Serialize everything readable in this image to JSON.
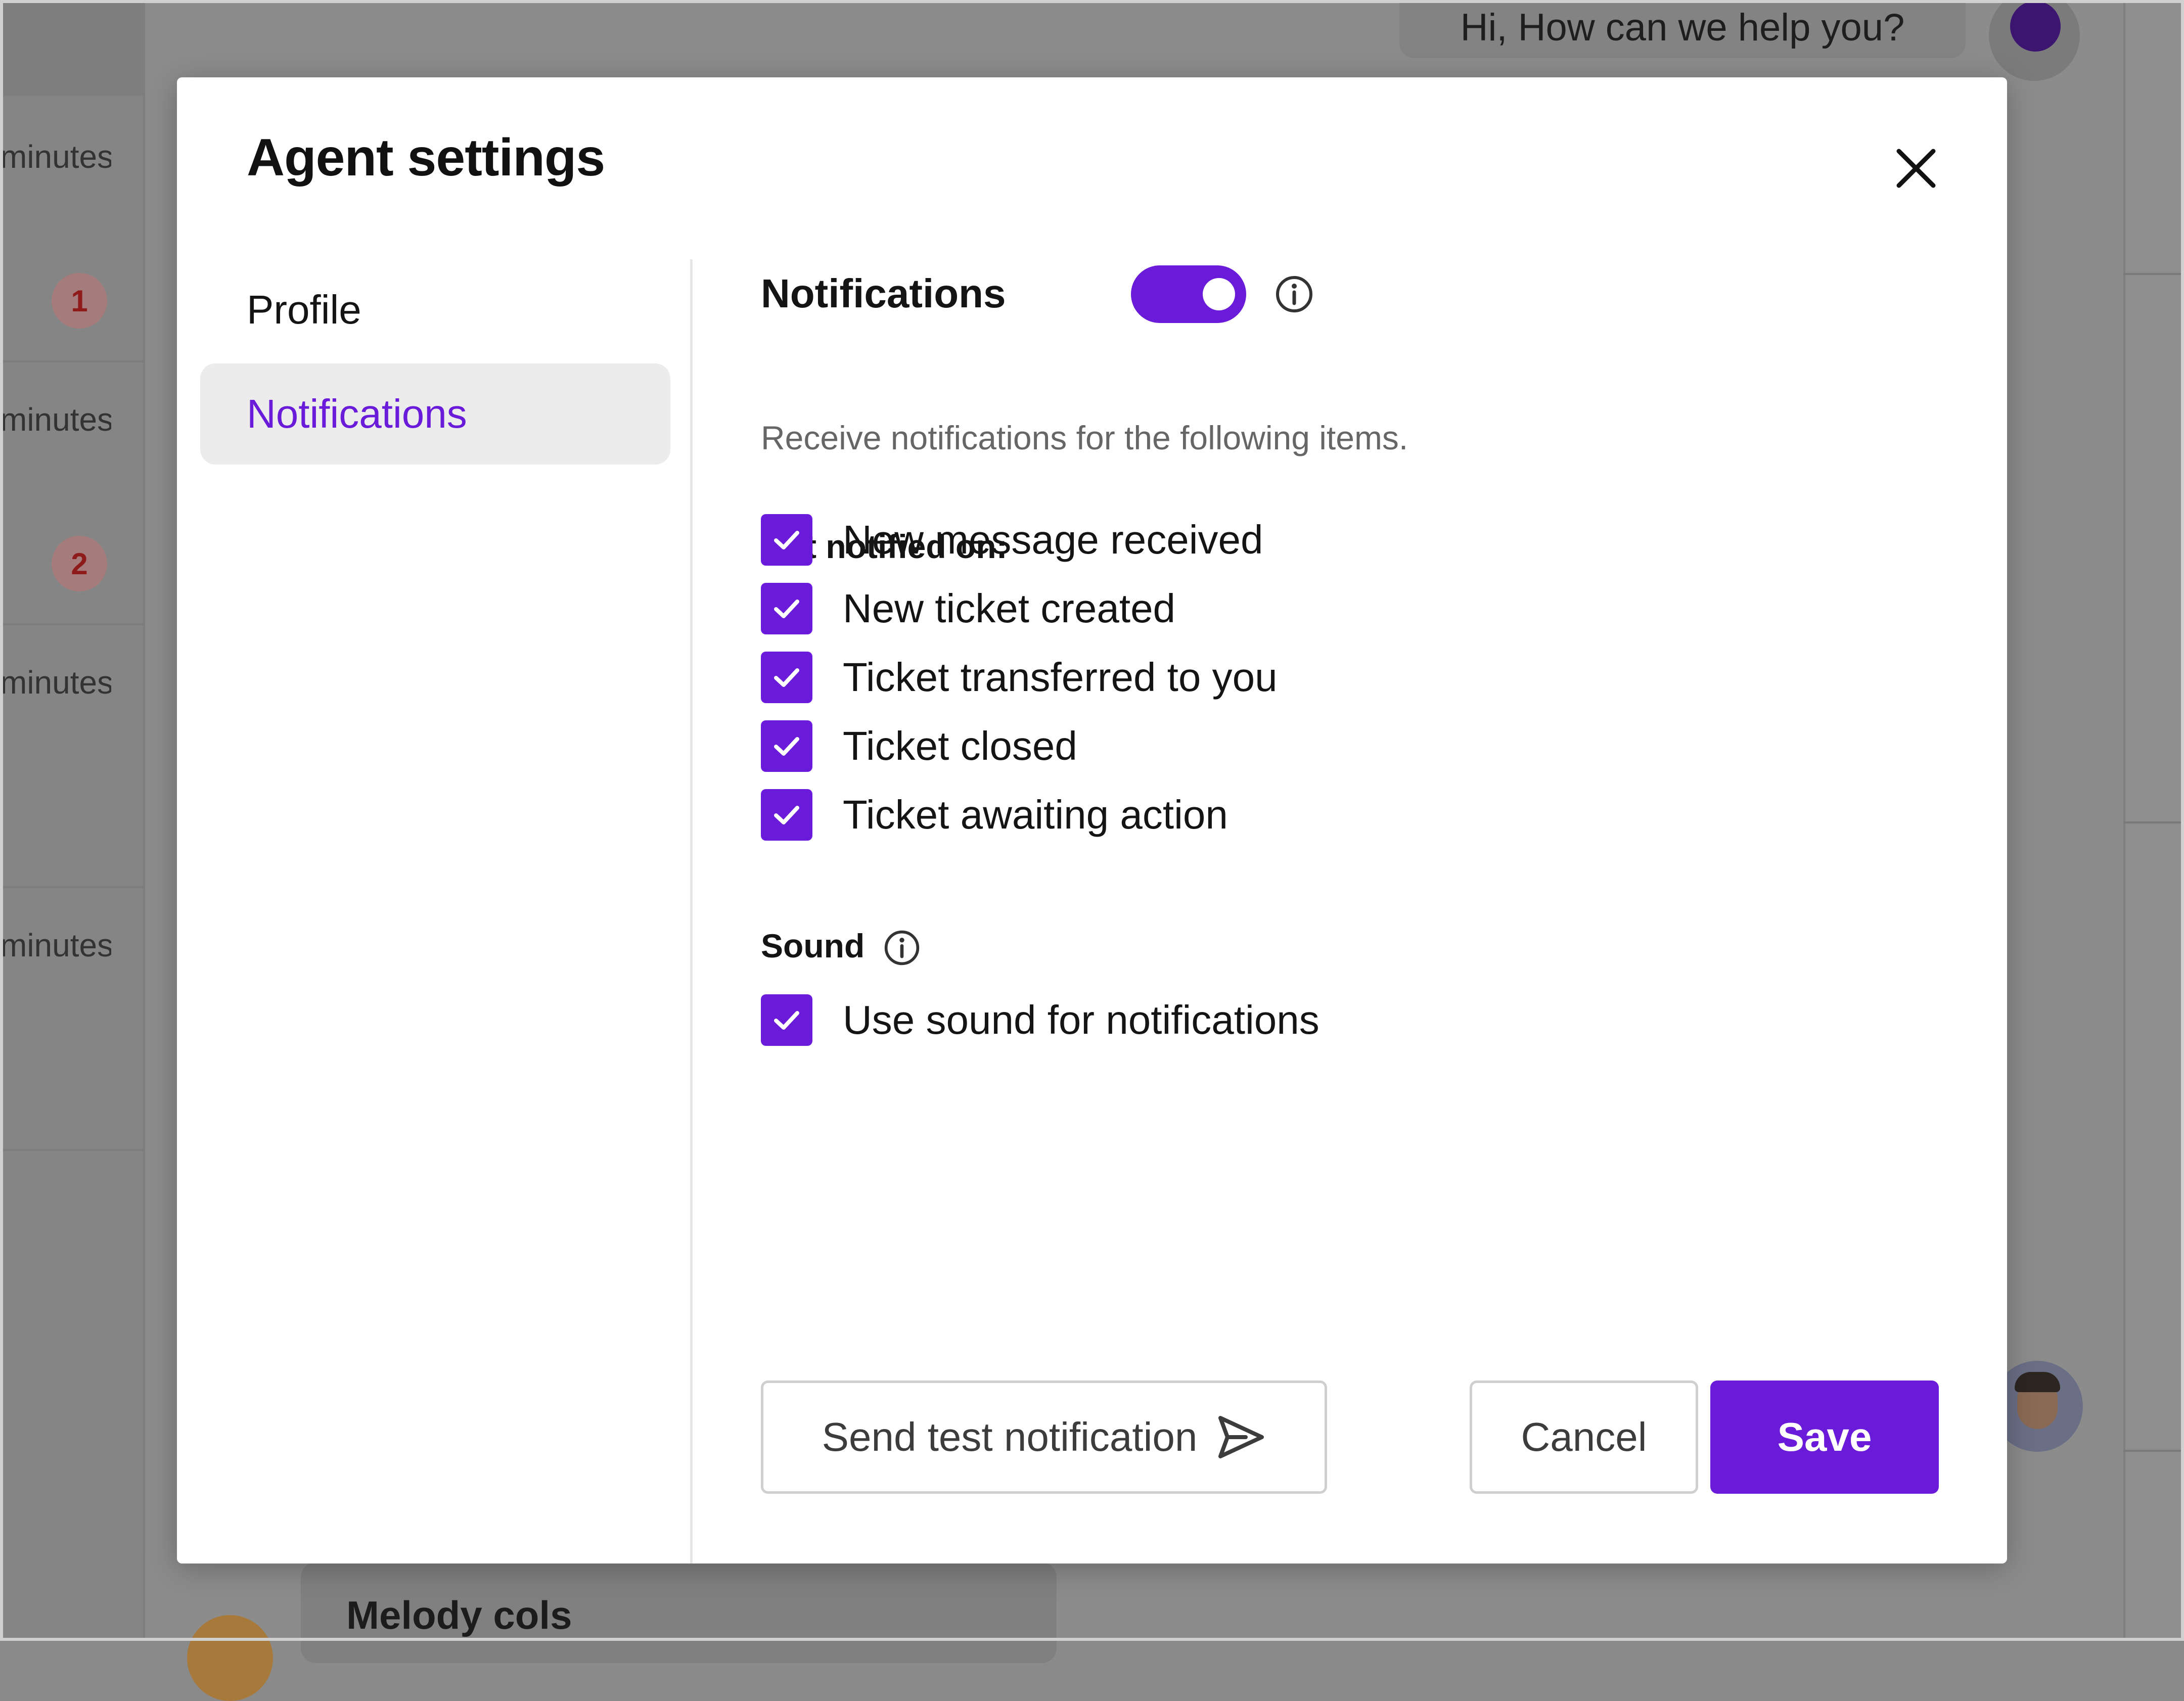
{
  "background": {
    "list_items": [
      {
        "time": "minutes",
        "badge": "1"
      },
      {
        "time": "minutes",
        "badge": "2"
      },
      {
        "time": "minutes",
        "badge": ""
      },
      {
        "time": "minutes",
        "badge": ""
      }
    ],
    "chat_greeting": "Hi, How can we help you?",
    "bottom_contact": "Melody cols"
  },
  "modal": {
    "title": "Agent settings",
    "close_icon": "close-icon",
    "nav": [
      {
        "label": "Profile",
        "active": false
      },
      {
        "label": "Notifications",
        "active": true
      }
    ],
    "notifications": {
      "title": "Notifications",
      "enabled": true,
      "subtitle": "Receive notifications for the following items.",
      "group_label": "Get notified on:",
      "items": [
        {
          "label": "New message received",
          "checked": true
        },
        {
          "label": "New ticket created",
          "checked": true
        },
        {
          "label": "Ticket transferred to you",
          "checked": true
        },
        {
          "label": "Ticket closed",
          "checked": true
        },
        {
          "label": "Ticket awaiting action",
          "checked": true
        }
      ]
    },
    "sound": {
      "label": "Sound",
      "option": {
        "label": "Use sound for notifications",
        "checked": true
      }
    },
    "buttons": {
      "test": "Send test notification",
      "cancel": "Cancel",
      "save": "Save"
    }
  },
  "colors": {
    "accent": "#6a1bd9",
    "overlay": "#8c8c8c",
    "active_nav_bg": "#ececec"
  }
}
